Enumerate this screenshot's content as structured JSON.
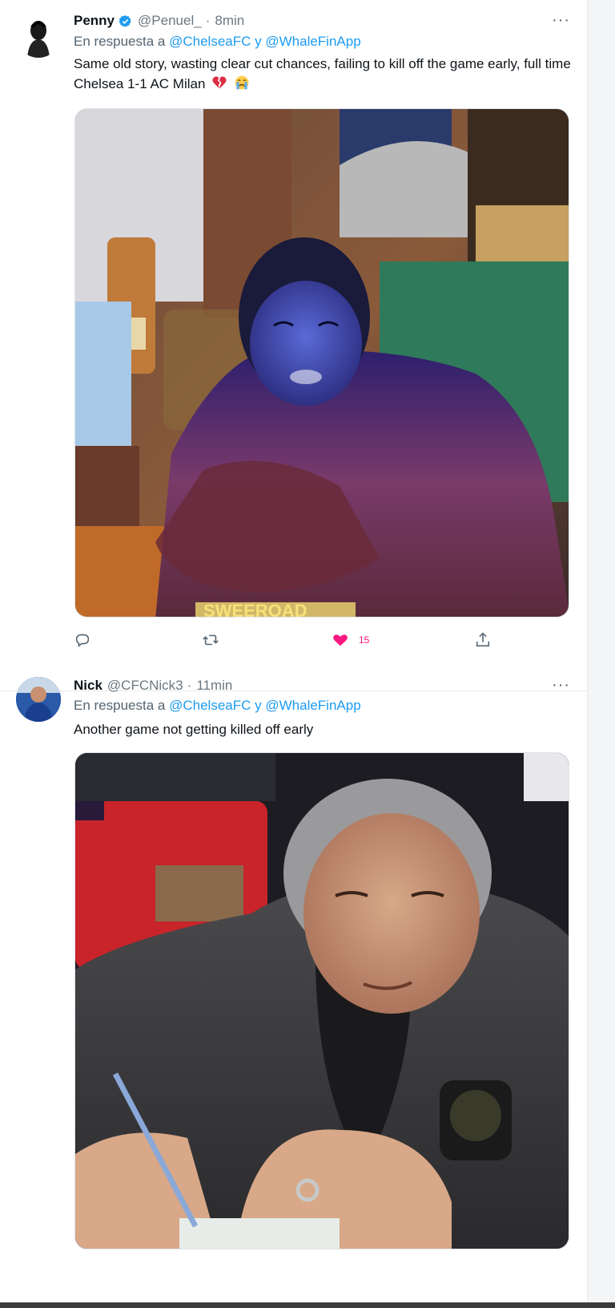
{
  "tweets": [
    {
      "name": "Penny",
      "verified": true,
      "handle": "@Penuel_",
      "time": "8min",
      "reply_prefix": "En respuesta a",
      "reply_to_1": "@ChelseaFC",
      "reply_joiner": "y",
      "reply_to_2": "@WhaleFinApp",
      "text": "Same old story, wasting clear cut chances, failing to kill off the game early, full time Chelsea 1-1 AC Milan",
      "emojis": [
        "broken-heart-icon",
        "crying-face-icon"
      ],
      "media_watermark": "SWEEROAD",
      "likes": "15",
      "liked": true
    },
    {
      "name": "Nick",
      "verified": false,
      "handle": "@CFCNick3",
      "time": "11min",
      "reply_prefix": "En respuesta a",
      "reply_to_1": "@ChelseaFC",
      "reply_joiner": "y",
      "reply_to_2": "@WhaleFinApp",
      "text": "Another game not getting killed off early"
    }
  ],
  "ui": {
    "more_label": "···",
    "dot": "·"
  },
  "colors": {
    "accent": "#1d9bf0",
    "like": "#f91880",
    "muted": "#536471"
  }
}
